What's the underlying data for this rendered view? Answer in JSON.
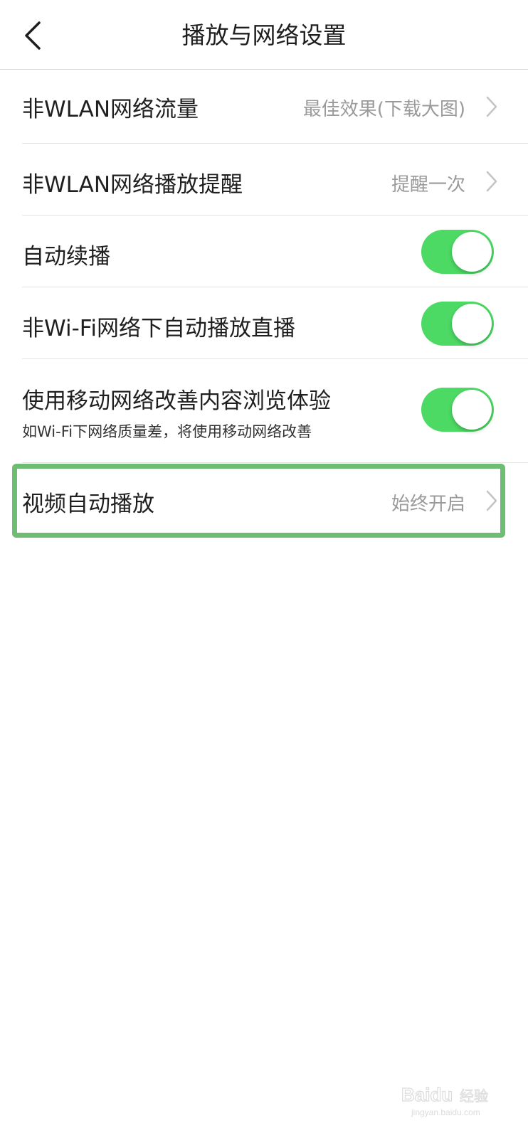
{
  "header": {
    "title": "播放与网络设置",
    "back_icon": "chevron-left-icon"
  },
  "settings": [
    {
      "label": "非WLAN网络流量",
      "value": "最佳效果(下载大图)",
      "type": "link"
    },
    {
      "label": "非WLAN网络播放提醒",
      "value": "提醒一次",
      "type": "link"
    },
    {
      "label": "自动续播",
      "type": "toggle",
      "on": true
    },
    {
      "label": "非Wi-Fi网络下自动播放直播",
      "type": "toggle",
      "on": true
    },
    {
      "label": "使用移动网络改善内容浏览体验",
      "sublabel": "如Wi-Fi下网络质量差，将使用移动网络改善",
      "type": "toggle",
      "on": true
    },
    {
      "label": "视频自动播放",
      "value": "始终开启",
      "type": "link",
      "highlighted": true
    }
  ],
  "colors": {
    "toggle_on": "#4cd964",
    "highlight_border": "#6dbd72",
    "value_text": "#9a9a9a"
  },
  "watermark": {
    "brand": "Baidu",
    "subtitle": "经验",
    "site": "jingyan.baidu.com"
  }
}
